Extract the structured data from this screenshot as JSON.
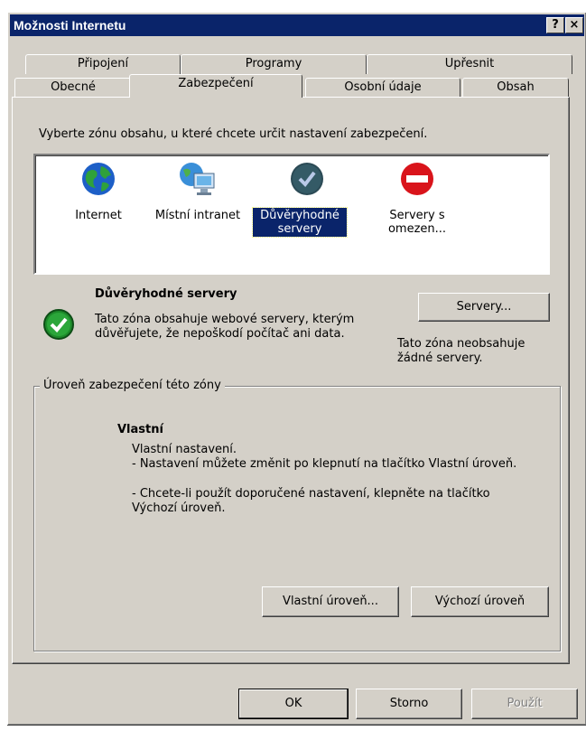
{
  "window": {
    "title": "Možnosti Internetu",
    "help": "?",
    "close": "×"
  },
  "tabs_back": [
    "Připojení",
    "Programy",
    "Upřesnit"
  ],
  "tabs_front": [
    "Obecné",
    "Zabezpečení",
    "Osobní údaje",
    "Obsah"
  ],
  "instruction": "Vyberte zónu obsahu, u které chcete určit nastavení zabezpečení.",
  "zones": [
    {
      "label": "Internet",
      "icon": "globe-icon"
    },
    {
      "label": "Místní intranet",
      "icon": "intranet-icon"
    },
    {
      "label": "Důvěryhodné servery",
      "icon": "trusted-check-icon",
      "selected": true
    },
    {
      "label": "Servery s omezen...",
      "icon": "restricted-icon"
    }
  ],
  "zone_info": {
    "title": "Důvěryhodné servery",
    "description": "Tato zóna obsahuje webové servery, kterým důvěřujete, že nepoškodí počítač ani data.",
    "servers_button": "Servery...",
    "no_servers": "Tato zóna neobsahuje žádné servery."
  },
  "security_level": {
    "legend": "Úroveň zabezpečení této zóny",
    "name": "Vlastní",
    "lines": [
      "Vlastní nastavení.",
      "- Nastavení můžete změnit po klepnutí na tlačítko Vlastní úroveň.",
      "- Chcete-li použít doporučené nastavení, klepněte na tlačítko Výchozí úroveň."
    ],
    "custom_button": "Vlastní úroveň...",
    "default_button": "Výchozí úroveň"
  },
  "footer": {
    "ok": "OK",
    "cancel": "Storno",
    "apply": "Použít"
  },
  "colors": {
    "titlebar": "#0a246a",
    "face": "#d4d0c8",
    "check_green": "#1d8a2a",
    "restricted_red": "#d9141b",
    "trusted_dark": "#2b4a55"
  }
}
